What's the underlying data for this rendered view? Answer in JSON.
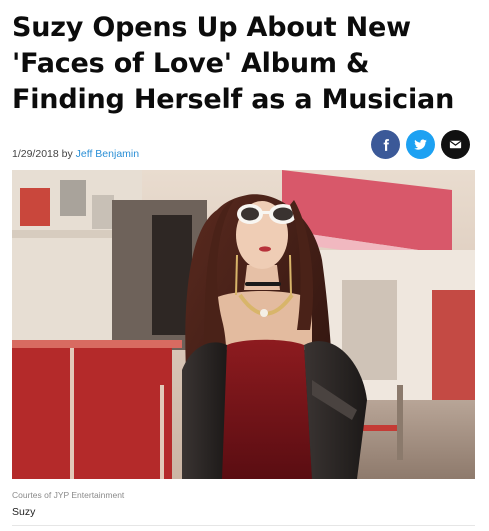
{
  "article": {
    "headline_lines": [
      "Suzy Opens Up About New",
      "'Faces of Love' Album &",
      "Finding Herself as a Musician"
    ],
    "date": "1/29/2018",
    "by": "by",
    "author": "Jeff Benjamin"
  },
  "share": {
    "buttons": [
      {
        "icon": "facebook-icon",
        "color": "#3b5998"
      },
      {
        "icon": "twitter-icon",
        "color": "#1da1f2"
      },
      {
        "icon": "email-icon",
        "color": "#111111"
      }
    ]
  },
  "image": {
    "credit": "Courtes of JYP Entertainment",
    "caption": "Suzy"
  }
}
